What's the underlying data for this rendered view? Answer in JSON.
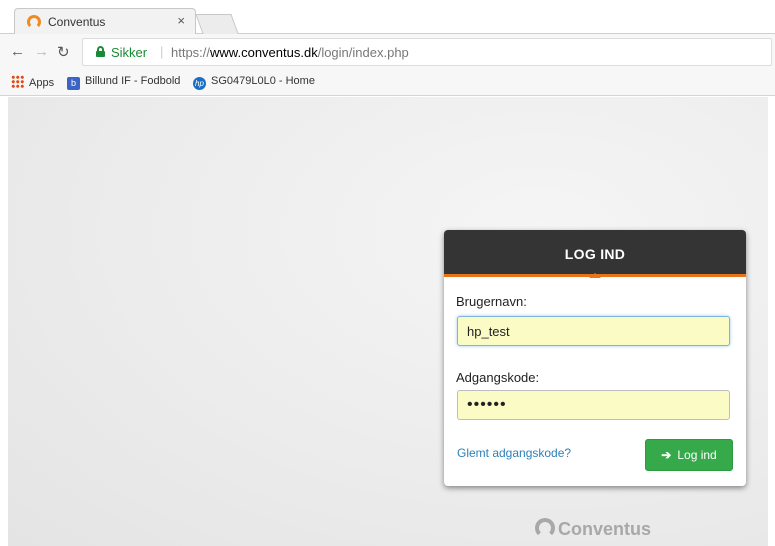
{
  "browser": {
    "tab": {
      "title": "Conventus",
      "close": "×"
    },
    "address": {
      "secure_label": "Sikker",
      "separator": "|",
      "scheme": "https://",
      "host": "www.conventus.dk",
      "path": "/login/index.php"
    },
    "bookmarks": [
      {
        "label": "Apps",
        "icon": "apps-grid-icon"
      },
      {
        "label": "Billund IF - Fodbold",
        "icon": "billund-favicon"
      },
      {
        "label": "SG0479L0L0 - Home",
        "icon": "hp-logo-icon"
      }
    ]
  },
  "login": {
    "title": "LOG IND",
    "username_label": "Brugernavn:",
    "username_value": "hp_test",
    "password_label": "Adgangskode:",
    "password_value": "••••••",
    "forgot_link": "Glemt adgangskode?",
    "submit_label": "Log ind"
  },
  "footer": {
    "brand": "Conventus"
  },
  "colors": {
    "accent_orange": "#e8731d",
    "header_dark": "#343434",
    "button_green": "#36a94a",
    "link_blue": "#2e80b8",
    "autofill_yellow": "#fbfbc6",
    "secure_green": "#1a8a34"
  }
}
